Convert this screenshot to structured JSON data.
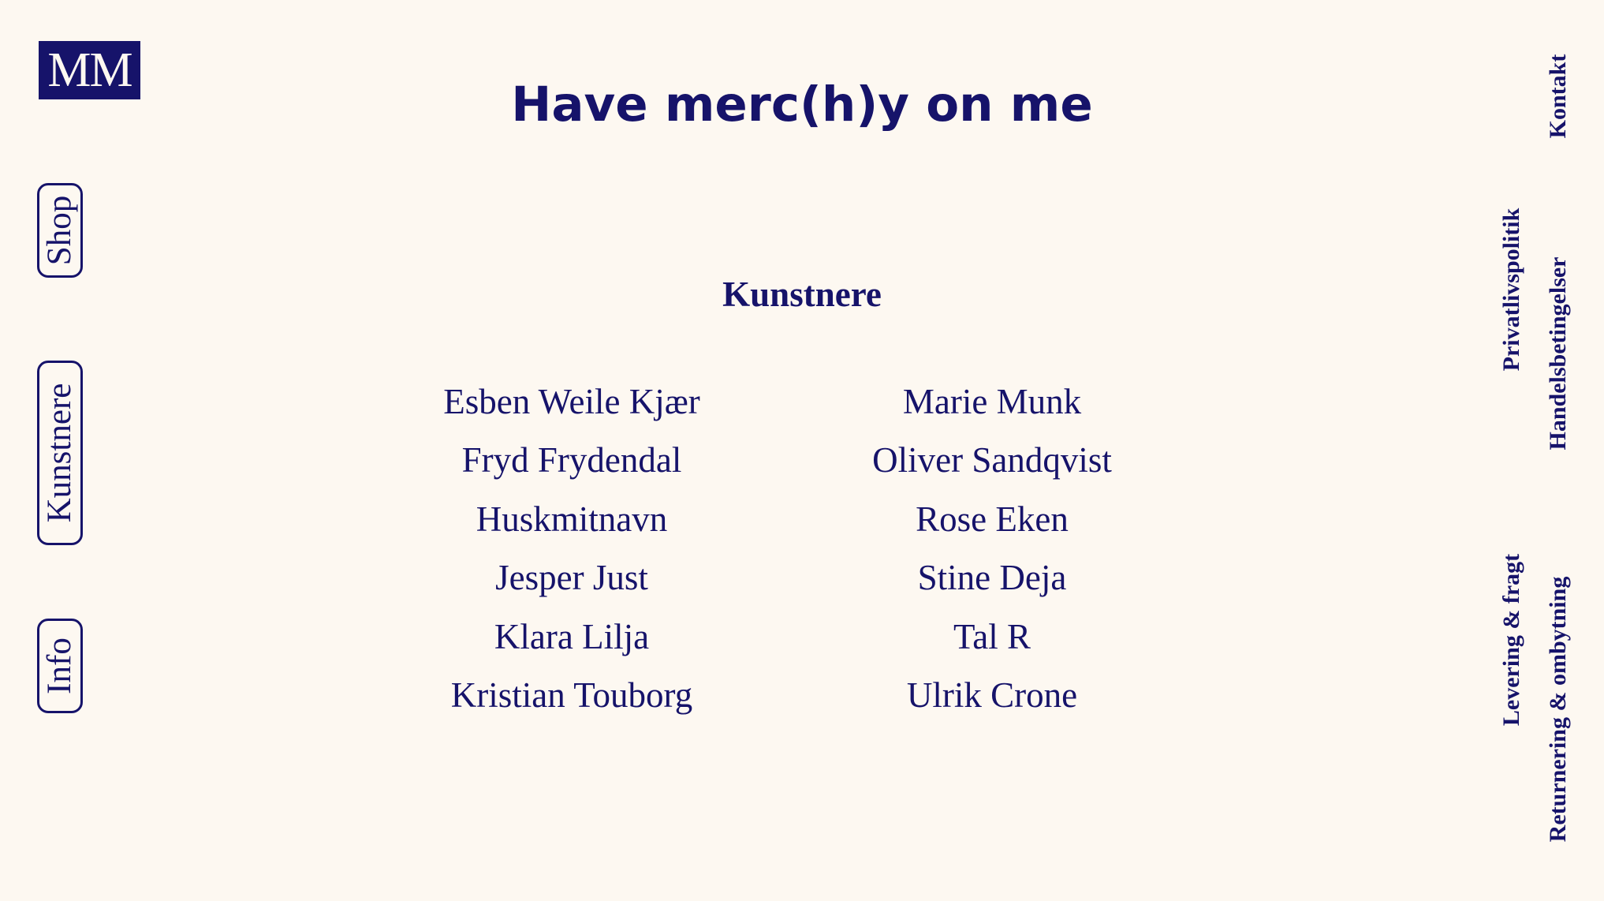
{
  "logo": {
    "text": "MM"
  },
  "site_title": "Have merc(h)y on me",
  "nav": {
    "shop": "Shop",
    "kunstnere": "Kunstnere",
    "info": "Info"
  },
  "section_title": "Kunstnere",
  "artists": {
    "left": [
      "Esben Weile Kjær",
      "Fryd Frydendal",
      "Huskmitnavn",
      "Jesper Just",
      "Klara Lilja",
      "Kristian Touborg"
    ],
    "right": [
      "Marie Munk",
      "Oliver Sandqvist",
      "Rose Eken",
      "Stine Deja",
      "Tal R",
      "Ulrik Crone"
    ]
  },
  "footer_links": {
    "kontakt": "Kontakt",
    "privatlivspolitik": "Privatlivspolitik",
    "handelsbetingelser": "Handelsbetingelser",
    "levering": "Levering & fragt",
    "returnering": "Returnering & ombytning"
  },
  "colors": {
    "background": "#fdf8f1",
    "accent": "#16136a"
  }
}
